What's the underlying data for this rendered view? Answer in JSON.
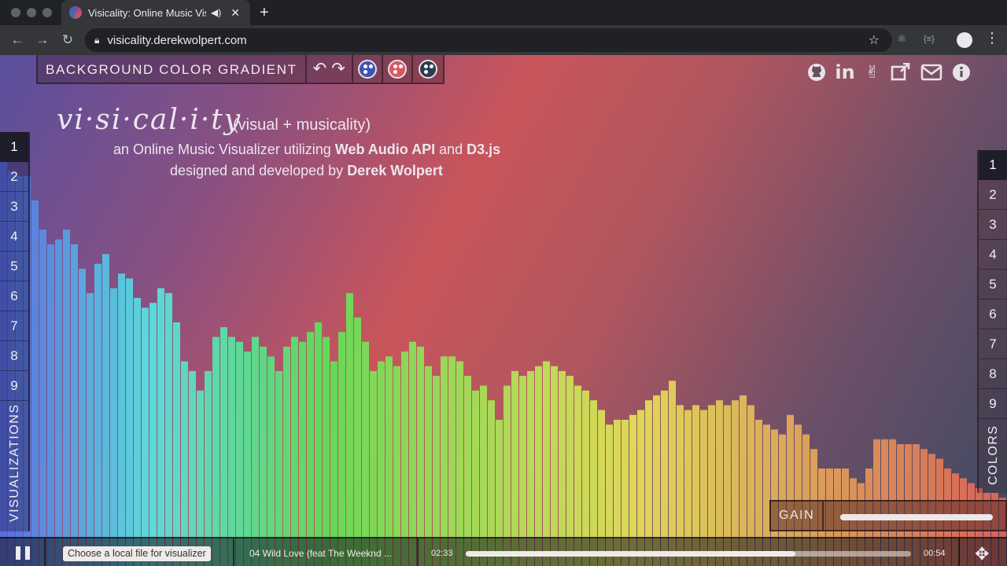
{
  "browser": {
    "tab_title": "Visicality: Online Music Visualizer",
    "url": "visicality.derekwolpert.com",
    "new_tab": "+",
    "close": "✕"
  },
  "bg_toolbar": {
    "label": "BACKGROUND COLOR GRADIENT",
    "palettes": [
      "#3d55b5",
      "#d65a62",
      "#2d3d4f"
    ]
  },
  "social_icons": [
    "github-icon",
    "linkedin-icon",
    "angellist-icon",
    "external-link-icon",
    "mail-icon",
    "info-icon"
  ],
  "header": {
    "logo": "vi·si·cal·i·ty",
    "logo_sub": "(visual + musicality)",
    "tagline_prefix": "an Online Music Visualizer utilizing ",
    "tagline_api": "Web Audio API",
    "tagline_and": " and ",
    "tagline_d3": "D3.js",
    "credit_prefix": "designed and developed by ",
    "credit_name": "Derek Wolpert"
  },
  "visualizations": {
    "label": "VISUALIZATIONS",
    "items": [
      "1",
      "2",
      "3",
      "4",
      "5",
      "6",
      "7",
      "8",
      "9"
    ],
    "active": 0
  },
  "colors": {
    "label": "COLORS",
    "items": [
      "1",
      "2",
      "3",
      "4",
      "5",
      "6",
      "7",
      "8",
      "9"
    ],
    "active": 0
  },
  "gain": {
    "label": "GAIN",
    "level": 1.0
  },
  "player": {
    "file_button": "Choose a local file for visualizer",
    "track": "04 Wild Love (feat The Weeknd ...",
    "elapsed": "02:33",
    "remaining": "00:54",
    "progress": 0.74
  },
  "visualizer": {
    "levels": [
      0.83,
      0.81,
      0.8,
      0.8,
      0.75,
      0.69,
      0.66,
      0.67,
      0.69,
      0.66,
      0.61,
      0.56,
      0.62,
      0.64,
      0.57,
      0.6,
      0.59,
      0.55,
      0.53,
      0.54,
      0.57,
      0.56,
      0.5,
      0.42,
      0.4,
      0.36,
      0.4,
      0.47,
      0.49,
      0.47,
      0.46,
      0.44,
      0.47,
      0.45,
      0.43,
      0.4,
      0.45,
      0.47,
      0.46,
      0.48,
      0.5,
      0.47,
      0.42,
      0.48,
      0.56,
      0.51,
      0.46,
      0.4,
      0.42,
      0.43,
      0.41,
      0.44,
      0.46,
      0.45,
      0.41,
      0.39,
      0.43,
      0.43,
      0.42,
      0.39,
      0.36,
      0.37,
      0.34,
      0.3,
      0.37,
      0.4,
      0.39,
      0.4,
      0.41,
      0.42,
      0.41,
      0.4,
      0.39,
      0.37,
      0.36,
      0.34,
      0.32,
      0.29,
      0.3,
      0.3,
      0.31,
      0.32,
      0.34,
      0.35,
      0.36,
      0.38,
      0.33,
      0.32,
      0.33,
      0.32,
      0.33,
      0.34,
      0.33,
      0.34,
      0.35,
      0.33,
      0.3,
      0.29,
      0.28,
      0.27,
      0.31,
      0.29,
      0.27,
      0.24,
      0.2,
      0.2,
      0.2,
      0.2,
      0.18,
      0.17,
      0.2,
      0.26,
      0.26,
      0.26,
      0.25,
      0.25,
      0.25,
      0.24,
      0.23,
      0.22,
      0.2,
      0.19,
      0.18,
      0.17,
      0.16,
      0.15,
      0.15,
      0.14
    ]
  }
}
